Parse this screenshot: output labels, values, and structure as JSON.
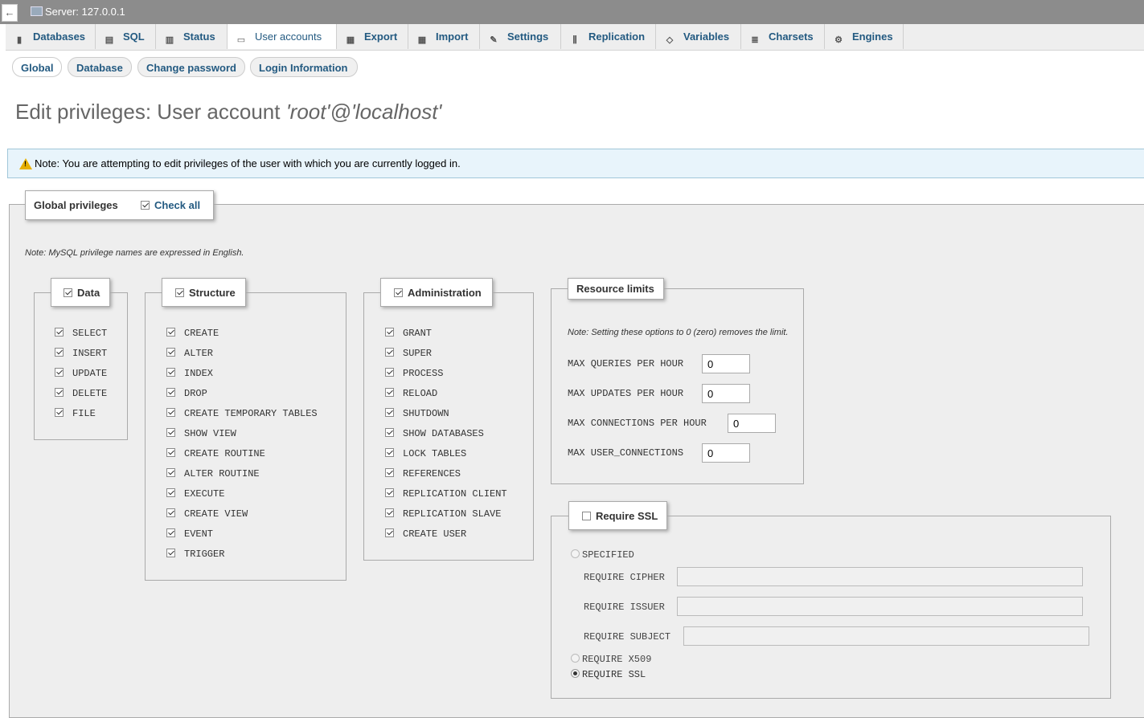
{
  "topbar": {
    "back_glyph": "←",
    "server_label": "Server: 127.0.0.1"
  },
  "tabs": [
    {
      "label": "Databases",
      "icon": "database-icon"
    },
    {
      "label": "SQL",
      "icon": "sql-icon"
    },
    {
      "label": "Status",
      "icon": "status-icon"
    },
    {
      "label": "User accounts",
      "icon": "user-accounts-icon"
    },
    {
      "label": "Export",
      "icon": "export-icon"
    },
    {
      "label": "Import",
      "icon": "import-icon"
    },
    {
      "label": "Settings",
      "icon": "wrench-icon"
    },
    {
      "label": "Replication",
      "icon": "replication-icon"
    },
    {
      "label": "Variables",
      "icon": "variables-icon"
    },
    {
      "label": "Charsets",
      "icon": "charsets-icon"
    },
    {
      "label": "Engines",
      "icon": "engines-icon"
    }
  ],
  "subtabs": [
    "Global",
    "Database",
    "Change password",
    "Login Information"
  ],
  "title": {
    "prefix": "Edit privileges: User account ",
    "account": "'root'@'localhost'"
  },
  "notice": "Note: You are attempting to edit privileges of the user with which you are currently logged in.",
  "global": {
    "legend": "Global privileges",
    "check_all": "Check all",
    "note": "Note: MySQL privilege names are expressed in English."
  },
  "data_group": {
    "legend": "Data",
    "items": [
      "SELECT",
      "INSERT",
      "UPDATE",
      "DELETE",
      "FILE"
    ]
  },
  "structure_group": {
    "legend": "Structure",
    "items": [
      "CREATE",
      "ALTER",
      "INDEX",
      "DROP",
      "CREATE TEMPORARY TABLES",
      "SHOW VIEW",
      "CREATE ROUTINE",
      "ALTER ROUTINE",
      "EXECUTE",
      "CREATE VIEW",
      "EVENT",
      "TRIGGER"
    ]
  },
  "admin_group": {
    "legend": "Administration",
    "items": [
      "GRANT",
      "SUPER",
      "PROCESS",
      "RELOAD",
      "SHUTDOWN",
      "SHOW DATABASES",
      "LOCK TABLES",
      "REFERENCES",
      "REPLICATION CLIENT",
      "REPLICATION SLAVE",
      "CREATE USER"
    ]
  },
  "resource_limits": {
    "legend": "Resource limits",
    "note": "Note: Setting these options to 0 (zero) removes the limit.",
    "fields": [
      {
        "label": "MAX QUERIES PER HOUR",
        "value": "0"
      },
      {
        "label": "MAX UPDATES PER HOUR",
        "value": "0"
      },
      {
        "label": "MAX CONNECTIONS PER HOUR",
        "value": "0"
      },
      {
        "label": "MAX USER_CONNECTIONS",
        "value": "0"
      }
    ]
  },
  "ssl": {
    "legend": "Require SSL",
    "specified": "SPECIFIED",
    "cipher": "REQUIRE CIPHER",
    "issuer": "REQUIRE ISSUER",
    "subject": "REQUIRE SUBJECT",
    "x509": "REQUIRE X509",
    "require_ssl": "REQUIRE SSL"
  }
}
